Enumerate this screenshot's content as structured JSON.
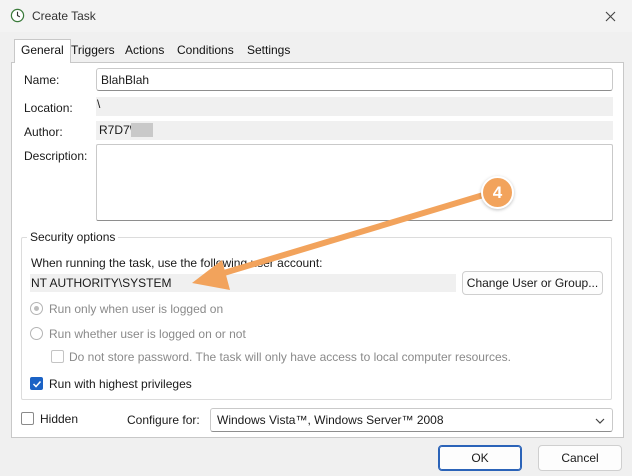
{
  "window": {
    "title": "Create Task",
    "close_label": "✕"
  },
  "tabs": [
    {
      "label": "General",
      "active": true
    },
    {
      "label": "Triggers"
    },
    {
      "label": "Actions"
    },
    {
      "label": "Conditions"
    },
    {
      "label": "Settings"
    }
  ],
  "general": {
    "name_label": "Name:",
    "name_value": "BlahBlah",
    "location_label": "Location:",
    "location_value": "\\",
    "author_label": "Author:",
    "author_value": "R7D7\\",
    "description_label": "Description:",
    "description_value": ""
  },
  "security": {
    "group_title": "Security options",
    "run_as_prompt": "When running the task, use the following user account:",
    "account_value": "NT AUTHORITY\\SYSTEM",
    "change_user_button": "Change User or Group...",
    "radio_logged_on": "Run only when user is logged on",
    "radio_logged_on_or_not": "Run whether user is logged on or not",
    "do_not_store_password": "Do not store password.  The task will only have access to local computer resources.",
    "highest_privileges": "Run with highest privileges",
    "highest_privileges_checked": true
  },
  "bottom": {
    "hidden_label": "Hidden",
    "configure_label": "Configure for:",
    "configure_value": "Windows Vista™, Windows Server™ 2008"
  },
  "footer": {
    "ok_label": "OK",
    "cancel_label": "Cancel"
  },
  "annotation": {
    "step_number": "4",
    "color": "#f2a35c"
  },
  "colors": {
    "accent": "#1b62c5",
    "annotation": "#f2a35c"
  }
}
